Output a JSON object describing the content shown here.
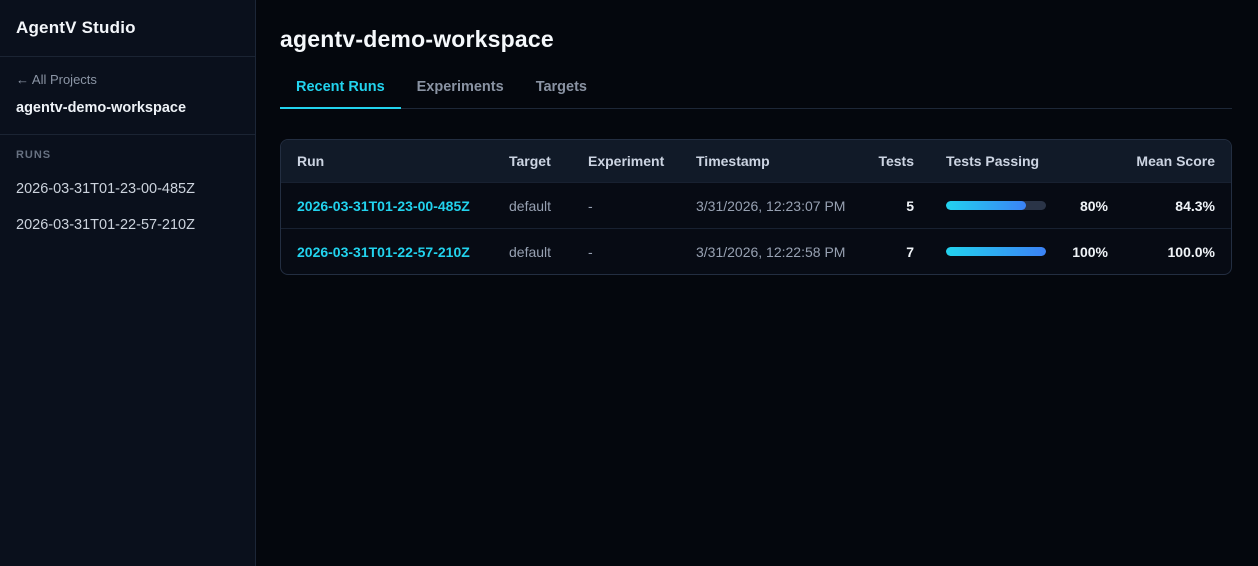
{
  "app": {
    "title": "AgentV Studio"
  },
  "sidebar": {
    "back_link": "← All Projects",
    "project_name": "agentv-demo-workspace",
    "runs_label": "RUNS",
    "runs": {
      "0": "2026-03-31T01-23-00-485Z",
      "1": "2026-03-31T01-22-57-210Z"
    }
  },
  "main": {
    "title": "agentv-demo-workspace",
    "tabs": {
      "0": {
        "label": "Recent Runs",
        "active": true
      },
      "1": {
        "label": "Experiments",
        "active": false
      },
      "2": {
        "label": "Targets",
        "active": false
      }
    }
  },
  "table": {
    "columns": {
      "0": "Run",
      "1": "Target",
      "2": "Experiment",
      "3": "Timestamp",
      "4": "Tests",
      "5": "Tests Passing",
      "6": "Mean Score"
    },
    "rows": {
      "0": {
        "run": "2026-03-31T01-23-00-485Z",
        "target": "default",
        "experiment": "-",
        "timestamp": "3/31/2026, 12:23:07 PM",
        "tests": "5",
        "passing_pct": 80,
        "passing_label": "80%",
        "mean_score": "84.3%"
      },
      "1": {
        "run": "2026-03-31T01-22-57-210Z",
        "target": "default",
        "experiment": "-",
        "timestamp": "3/31/2026, 12:22:58 PM",
        "tests": "7",
        "passing_pct": 100,
        "passing_label": "100%",
        "mean_score": "100.0%"
      }
    }
  },
  "colors": {
    "accent_cyan": "#22d3ee",
    "bar_gradient_start": "#22d3ee",
    "bar_gradient_end": "#3b82f6",
    "bar_track": "#2a3447",
    "sidebar_bg": "#0a101c",
    "main_bg": "#04070d",
    "table_header_bg": "#111a28"
  }
}
